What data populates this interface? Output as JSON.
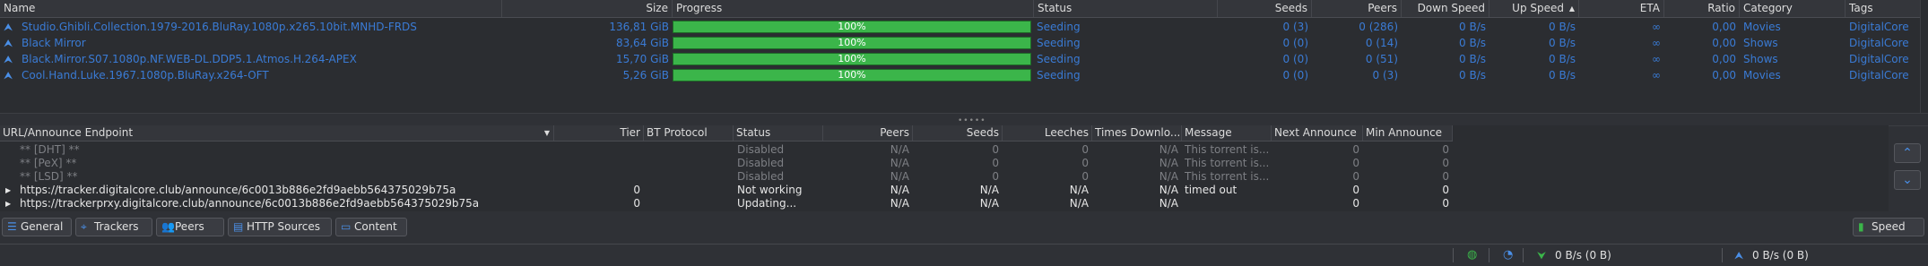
{
  "torrents": {
    "columns": {
      "name": "Name",
      "size": "Size",
      "progress": "Progress",
      "status": "Status",
      "seeds": "Seeds",
      "peers": "Peers",
      "down_speed": "Down Speed",
      "up_speed": "Up Speed",
      "eta": "ETA",
      "ratio": "Ratio",
      "category": "Category",
      "tags": "Tags"
    },
    "rows": [
      {
        "name": "Studio.Ghibli.Collection.1979-2016.BluRay.1080p.x265.10bit.MNHD-FRDS",
        "size": "136,81 GiB",
        "progress": "100%",
        "progress_value": 100,
        "status": "Seeding",
        "seeds": "0 (3)",
        "peers": "0 (286)",
        "down_speed": "0 B/s",
        "up_speed": "0 B/s",
        "eta": "∞",
        "ratio": "0,00",
        "category": "Movies",
        "tags": "DigitalCore"
      },
      {
        "name": "Black Mirror",
        "size": "83,64 GiB",
        "progress": "100%",
        "progress_value": 100,
        "status": "Seeding",
        "seeds": "0 (0)",
        "peers": "0 (14)",
        "down_speed": "0 B/s",
        "up_speed": "0 B/s",
        "eta": "∞",
        "ratio": "0,00",
        "category": "Shows",
        "tags": "DigitalCore"
      },
      {
        "name": "Black.Mirror.S07.1080p.NF.WEB-DL.DDP5.1.Atmos.H.264-APEX",
        "size": "15,70 GiB",
        "progress": "100%",
        "progress_value": 100,
        "status": "Seeding",
        "seeds": "0 (0)",
        "peers": "0 (51)",
        "down_speed": "0 B/s",
        "up_speed": "0 B/s",
        "eta": "∞",
        "ratio": "0,00",
        "category": "Shows",
        "tags": "DigitalCore"
      },
      {
        "name": "Cool.Hand.Luke.1967.1080p.BluRay.x264-OFT",
        "size": "5,26 GiB",
        "progress": "100%",
        "progress_value": 100,
        "status": "Seeding",
        "seeds": "0 (0)",
        "peers": "0 (3)",
        "down_speed": "0 B/s",
        "up_speed": "0 B/s",
        "eta": "∞",
        "ratio": "0,00",
        "category": "Movies",
        "tags": "DigitalCore"
      }
    ]
  },
  "trackers": {
    "columns": {
      "url": "URL/Announce Endpoint",
      "tier": "Tier",
      "bt_protocol": "BT Protocol",
      "status": "Status",
      "peers": "Peers",
      "seeds": "Seeds",
      "leeches": "Leeches",
      "times_downloaded": "Times Downlo...",
      "message": "Message",
      "next_announce": "Next Announce",
      "min_announce": "Min Announce"
    },
    "rows": [
      {
        "url": "** [DHT] **",
        "tier": "",
        "status": "Disabled",
        "peers": "N/A",
        "seeds": "0",
        "leeches": "0",
        "times": "N/A",
        "message": "This torrent is...",
        "next": "0",
        "min": "0",
        "dim": true
      },
      {
        "url": "** [PeX] **",
        "tier": "",
        "status": "Disabled",
        "peers": "N/A",
        "seeds": "0",
        "leeches": "0",
        "times": "N/A",
        "message": "This torrent is...",
        "next": "0",
        "min": "0",
        "dim": true
      },
      {
        "url": "** [LSD] **",
        "tier": "",
        "status": "Disabled",
        "peers": "N/A",
        "seeds": "0",
        "leeches": "0",
        "times": "N/A",
        "message": "This torrent is...",
        "next": "0",
        "min": "0",
        "dim": true
      },
      {
        "url": "https://tracker.digitalcore.club/announce/6c0013b886e2fd9aebb564375029b75a",
        "tier": "0",
        "status": "Not working",
        "peers": "N/A",
        "seeds": "N/A",
        "leeches": "N/A",
        "times": "N/A",
        "message": "timed out",
        "next": "0",
        "min": "0",
        "dim": false
      },
      {
        "url": "https://trackerprxy.digitalcore.club/announce/6c0013b886e2fd9aebb564375029b75a",
        "tier": "0",
        "status": "Updating...",
        "peers": "N/A",
        "seeds": "N/A",
        "leeches": "N/A",
        "times": "N/A",
        "message": "",
        "next": "0",
        "min": "0",
        "dim": false
      }
    ]
  },
  "tabs": {
    "general": "General",
    "trackers": "Trackers",
    "peers": "Peers",
    "http_sources": "HTTP Sources",
    "content": "Content",
    "speed": "Speed"
  },
  "statusbar": {
    "download": "0 B/s (0 B)",
    "upload": "0 B/s (0 B)"
  },
  "colors": {
    "accent": "#3a7bd5",
    "progress_green": "#3bb54a",
    "background": "#2b2d31"
  }
}
